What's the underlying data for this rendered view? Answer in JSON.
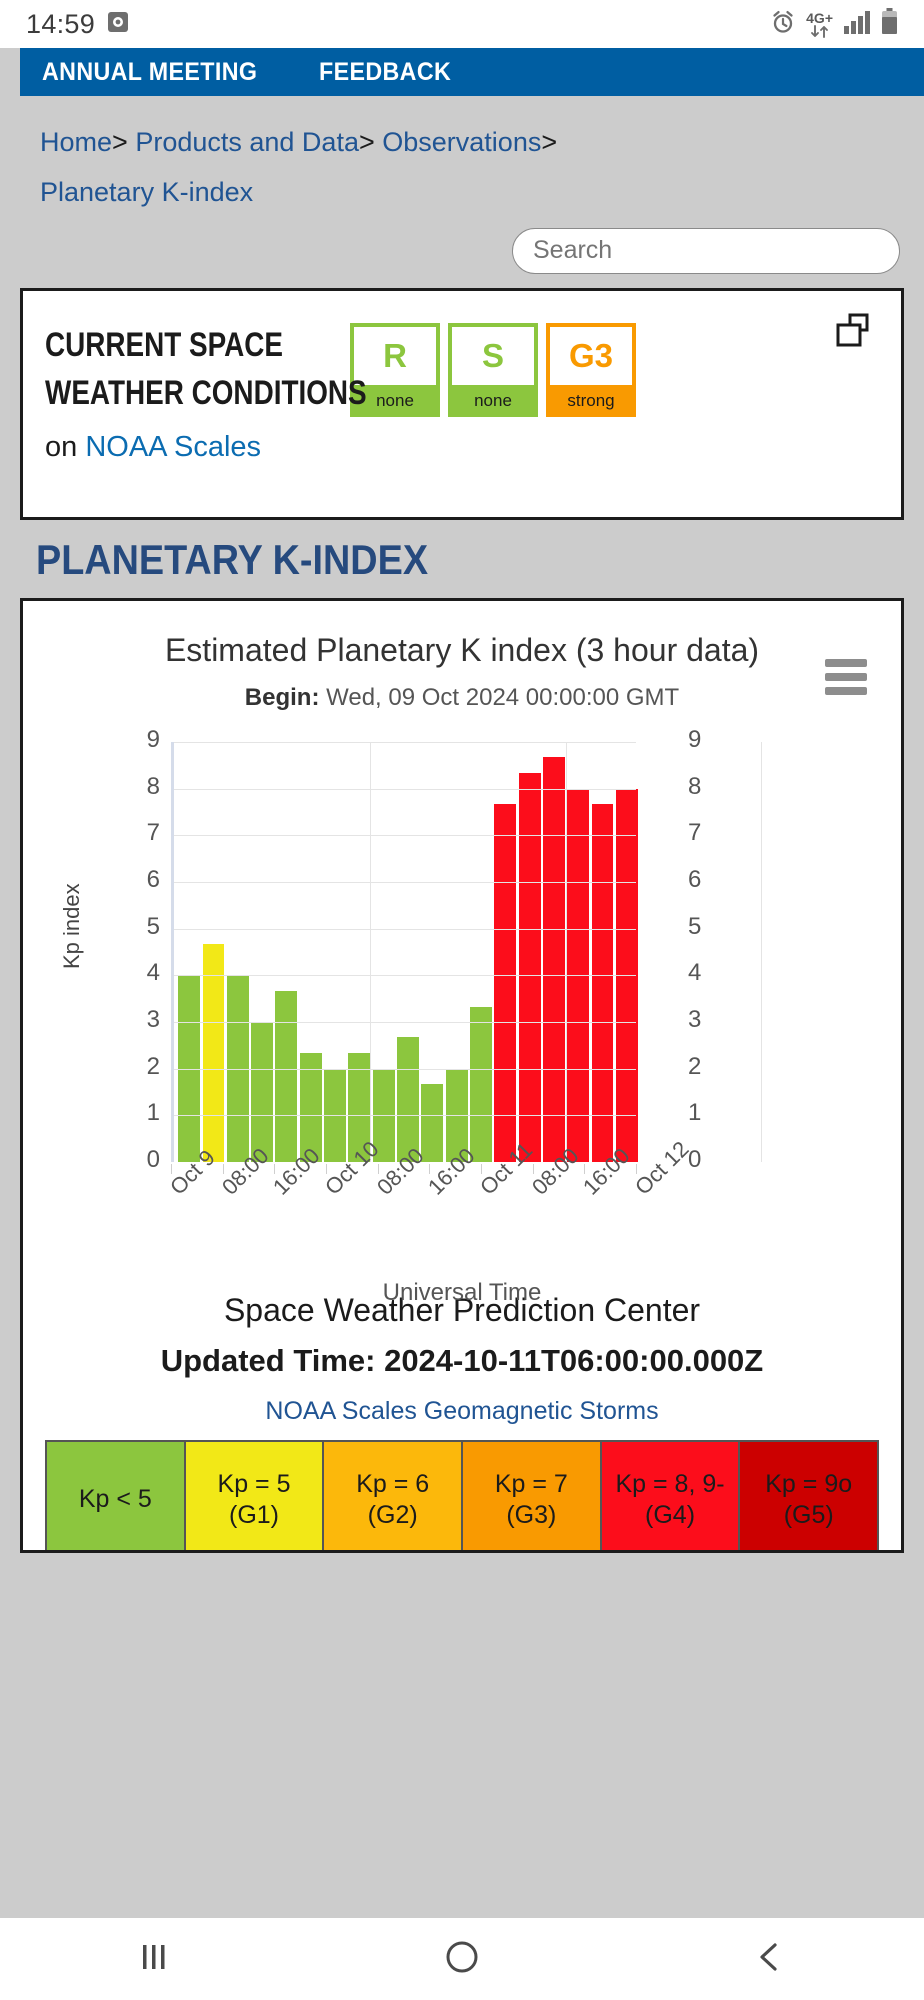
{
  "status_bar": {
    "time": "14:59",
    "network_label": "4G+",
    "icons": [
      "screen-record-icon",
      "alarm-icon",
      "network-4g-icon",
      "signal-icon",
      "battery-icon"
    ]
  },
  "nav": {
    "items": [
      {
        "label": "ANNUAL MEETING"
      },
      {
        "label": "FEEDBACK"
      }
    ],
    "background": "#005ea2"
  },
  "breadcrumb": {
    "items": [
      "Home",
      "Products and Data",
      "Observations",
      "Planetary K-index"
    ],
    "separator": ">"
  },
  "search": {
    "placeholder": "Search",
    "value": ""
  },
  "conditions": {
    "title_line1": "CURRENT SPACE",
    "title_line2": "WEATHER CONDITIONS",
    "sub_prefix": "on",
    "sub_link": "NOAA Scales",
    "scales": [
      {
        "letter": "R",
        "status": "none",
        "color": "#8cc63e"
      },
      {
        "letter": "S",
        "status": "none",
        "color": "#8cc63e"
      },
      {
        "letter": "G3",
        "status": "strong",
        "color": "#f99a01"
      }
    ]
  },
  "section_heading": "PLANETARY K-INDEX",
  "chart_footer": {
    "source": "Space Weather Prediction Center",
    "updated_label": "Updated Time:",
    "updated_value": "2024-10-11T06:00:00.000Z",
    "updated_full": "Updated Time: 2024-10-11T06:00:00.000Z",
    "legend_link": "NOAA Scales Geomagnetic Storms"
  },
  "legend": {
    "cells": [
      {
        "label": "Kp < 5",
        "color": "#8cc63e"
      },
      {
        "label": "Kp = 5 (G1)",
        "color": "#f2e817"
      },
      {
        "label": "Kp = 6 (G2)",
        "color": "#fcb80b"
      },
      {
        "label": "Kp = 7 (G3)",
        "color": "#f99a01"
      },
      {
        "label": "Kp = 8, 9- (G4)",
        "color": "#fc0d1b"
      },
      {
        "label": "Kp = 9o (G5)",
        "color": "#cc0000"
      }
    ]
  },
  "android_nav": {
    "recent": "|||",
    "home": "home-circle-icon",
    "back": "back-chevron-icon"
  },
  "chart_data": {
    "type": "bar",
    "title": "Estimated Planetary K index (3 hour data)",
    "subtitle_label": "Begin:",
    "subtitle_value": "Wed, 09 Oct 2024 00:00:00 GMT",
    "xlabel": "Universal Time",
    "ylabel": "Kp index",
    "ylim": [
      0,
      9
    ],
    "yticks": [
      0,
      1,
      2,
      3,
      4,
      5,
      6,
      7,
      8,
      9
    ],
    "grid": true,
    "legend_position": "below-chart",
    "xtick_labels": [
      "Oct 9",
      "08:00",
      "16:00",
      "Oct 10",
      "08:00",
      "16:00",
      "Oct 11",
      "08:00",
      "16:00",
      "Oct 12"
    ],
    "categories": [
      "Oct 9 00:00",
      "Oct 9 03:00",
      "Oct 9 06:00",
      "Oct 9 09:00",
      "Oct 9 12:00",
      "Oct 9 15:00",
      "Oct 9 18:00",
      "Oct 9 21:00",
      "Oct 10 00:00",
      "Oct 10 03:00",
      "Oct 10 06:00",
      "Oct 10 09:00",
      "Oct 10 12:00",
      "Oct 10 15:00",
      "Oct 10 18:00",
      "Oct 10 21:00",
      "Oct 11 00:00",
      "Oct 11 03:00",
      "Oct 11 06:00"
    ],
    "values": [
      4.0,
      4.67,
      4.0,
      3.0,
      3.67,
      2.33,
      2.0,
      2.33,
      2.0,
      2.67,
      1.67,
      2.0,
      3.33,
      7.67,
      8.33,
      8.67,
      8.0,
      7.67,
      8.0
    ],
    "colors": [
      "#8cc63e",
      "#f2e817",
      "#8cc63e",
      "#8cc63e",
      "#8cc63e",
      "#8cc63e",
      "#8cc63e",
      "#8cc63e",
      "#8cc63e",
      "#8cc63e",
      "#8cc63e",
      "#8cc63e",
      "#8cc63e",
      "#fc0d1b",
      "#fc0d1b",
      "#fc0d1b",
      "#fc0d1b",
      "#fc0d1b",
      "#fc0d1b"
    ]
  }
}
